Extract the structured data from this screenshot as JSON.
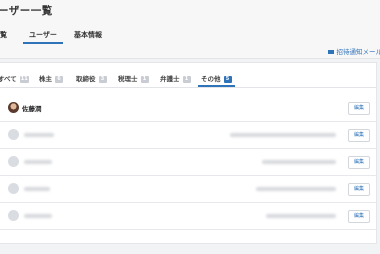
{
  "header": {
    "title": "ーザー一覧",
    "tabs": [
      {
        "label": "覧",
        "active": false
      },
      {
        "label": "ユーザー",
        "active": true
      },
      {
        "label": "基本情報",
        "active": false
      }
    ],
    "invite_label": "招待通知メール"
  },
  "filters": [
    {
      "label": "すべて",
      "count": "11",
      "active": false
    },
    {
      "label": "株主",
      "count": "6",
      "active": false
    },
    {
      "label": "取締役",
      "count": "3",
      "active": false
    },
    {
      "label": "税理士",
      "count": "1",
      "active": false
    },
    {
      "label": "弁護士",
      "count": "1",
      "active": false
    },
    {
      "label": "その他",
      "count": "5",
      "active": true
    }
  ],
  "users": [
    {
      "name": "佐藤潤",
      "avatar": "photo",
      "edit_label": "編集"
    },
    {
      "name": "",
      "avatar": "default",
      "edit_label": "編集"
    },
    {
      "name": "",
      "avatar": "default",
      "edit_label": "編集"
    },
    {
      "name": "",
      "avatar": "default",
      "edit_label": "編集"
    },
    {
      "name": "",
      "avatar": "default",
      "edit_label": "編集"
    }
  ],
  "colors": {
    "accent": "#2f73b8",
    "background": "#f2f3f5"
  }
}
